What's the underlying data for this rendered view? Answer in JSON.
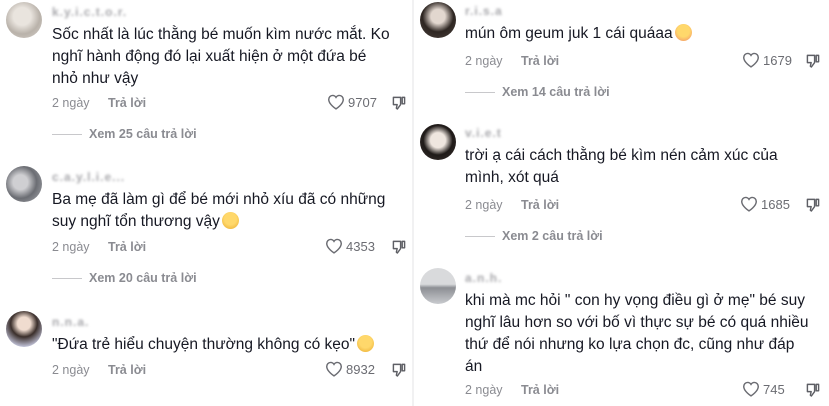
{
  "left": {
    "comments": [
      {
        "username": "k.y.i.c.t.o.r.",
        "lines": [
          "Sốc nhất là lúc thằng bé muốn kìm nước mắt. Ko",
          "nghĩ hành động đó lại xuất hiện ở một đứa bé",
          "nhỏ như vậy"
        ],
        "time": "2 ngày",
        "reply_label": "Trả lời",
        "likes": "9707",
        "view_replies": "Xem 25 câu trả lời"
      },
      {
        "username": "c.a.y.l.i.e...",
        "lines": [
          "Ba mẹ đã làm gì để bé mới nhỏ xíu đã có những",
          "suy nghĩ tổn thương vậy"
        ],
        "emoji": "pleading-face",
        "time": "2 ngày",
        "reply_label": "Trả lời",
        "likes": "4353",
        "view_replies": "Xem 20 câu trả lời"
      },
      {
        "username": "n.n.a.",
        "lines": [
          "\"Đứa trẻ hiểu chuyện thường không có kẹo\""
        ],
        "emoji": "pleading-face",
        "time": "2 ngày",
        "reply_label": "Trả lời",
        "likes": "8932"
      }
    ]
  },
  "right": {
    "comments": [
      {
        "username": "r.i.s.a",
        "lines": [
          "mún ôm geum juk 1 cái quáaa"
        ],
        "emoji": "smiling-face-with-hearts",
        "time": "2 ngày",
        "reply_label": "Trả lời",
        "likes": "1679",
        "view_replies": "Xem 14 câu trả lời"
      },
      {
        "username": "v.i.e.t",
        "lines": [
          "trời ạ cái cách thằng bé kìm nén cảm xúc của",
          "mình, xót quá"
        ],
        "time": "2 ngày",
        "reply_label": "Trả lời",
        "likes": "1685",
        "view_replies": "Xem 2 câu trả lời"
      },
      {
        "username": "a.n.h.",
        "lines": [
          "khi mà mc hỏi \" con hy vọng điều gì ở mẹ\" bé suy",
          "nghĩ lâu hơn so với bố vì thực sự bé có quá nhiều",
          "thứ để nói nhưng ko lựa chọn đc, cũng như đáp",
          "án"
        ],
        "time": "2 ngày",
        "reply_label": "Trả lời",
        "likes": "745"
      }
    ]
  },
  "colors": {
    "text": "#161823",
    "meta": "#8a8b91",
    "emoji": "#f5c343"
  }
}
